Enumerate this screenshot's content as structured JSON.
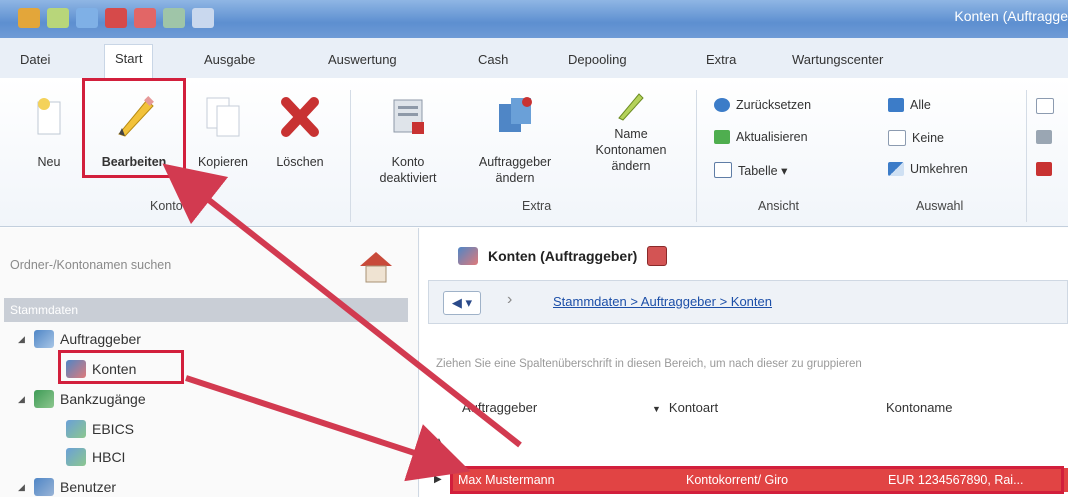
{
  "window": {
    "title": "Konten (Auftragge"
  },
  "colors": {
    "accent": "#d21f3c",
    "selection": "#e14444",
    "ribbon_bg": "#f1f5fa",
    "title_bar": "#5d8fd0"
  },
  "menu": {
    "tabs": [
      "Datei",
      "Start",
      "Ausgabe",
      "Auswertung",
      "Cash",
      "Depooling",
      "Extra",
      "Wartungscenter"
    ],
    "active": "Start"
  },
  "ribbon": {
    "konto": {
      "group_label": "Konto",
      "neu": "Neu",
      "bearbeiten": "Bearbeiten",
      "kopieren": "Kopieren",
      "loeschen": "Löschen"
    },
    "extra": {
      "group_label": "Extra",
      "konto_deaktiviert": "Konto deaktiviert",
      "auftraggeber_aendern": "Auftraggeber ändern",
      "kontonamen_aendern": "Name Kontonamen ändern"
    },
    "ansicht": {
      "group_label": "Ansicht",
      "zuruecksetzen": "Zurücksetzen",
      "aktualisieren": "Aktualisieren",
      "tabelle": "Tabelle ▾"
    },
    "auswahl": {
      "group_label": "Auswahl",
      "alle": "Alle",
      "keine": "Keine",
      "umkehren": "Umkehren"
    }
  },
  "sidebar": {
    "search_placeholder": "Ordner-/Kontonamen suchen",
    "header": "Stammdaten",
    "tree": [
      {
        "label": "Auftraggeber",
        "level": 1
      },
      {
        "label": "Konten",
        "level": 2,
        "selected": true
      },
      {
        "label": "Bankzugänge",
        "level": 1
      },
      {
        "label": "EBICS",
        "level": 2
      },
      {
        "label": "HBCI",
        "level": 2
      },
      {
        "label": "Benutzer",
        "level": 1
      }
    ]
  },
  "content": {
    "title": "Konten (Auftraggeber)",
    "breadcrumb": "Stammdaten > Auftraggeber > Konten",
    "group_hint": "Ziehen Sie eine Spaltenüberschrift in diesen Bereich, um nach dieser zu gruppieren",
    "columns": [
      "Auftraggeber",
      "Kontoart",
      "Kontoname"
    ],
    "rows": [
      {
        "auftraggeber": "Max Mustermann",
        "kontoart": "Kontokorrent/ Giro",
        "kontoname": "EUR 1234567890, Rai..."
      }
    ]
  }
}
